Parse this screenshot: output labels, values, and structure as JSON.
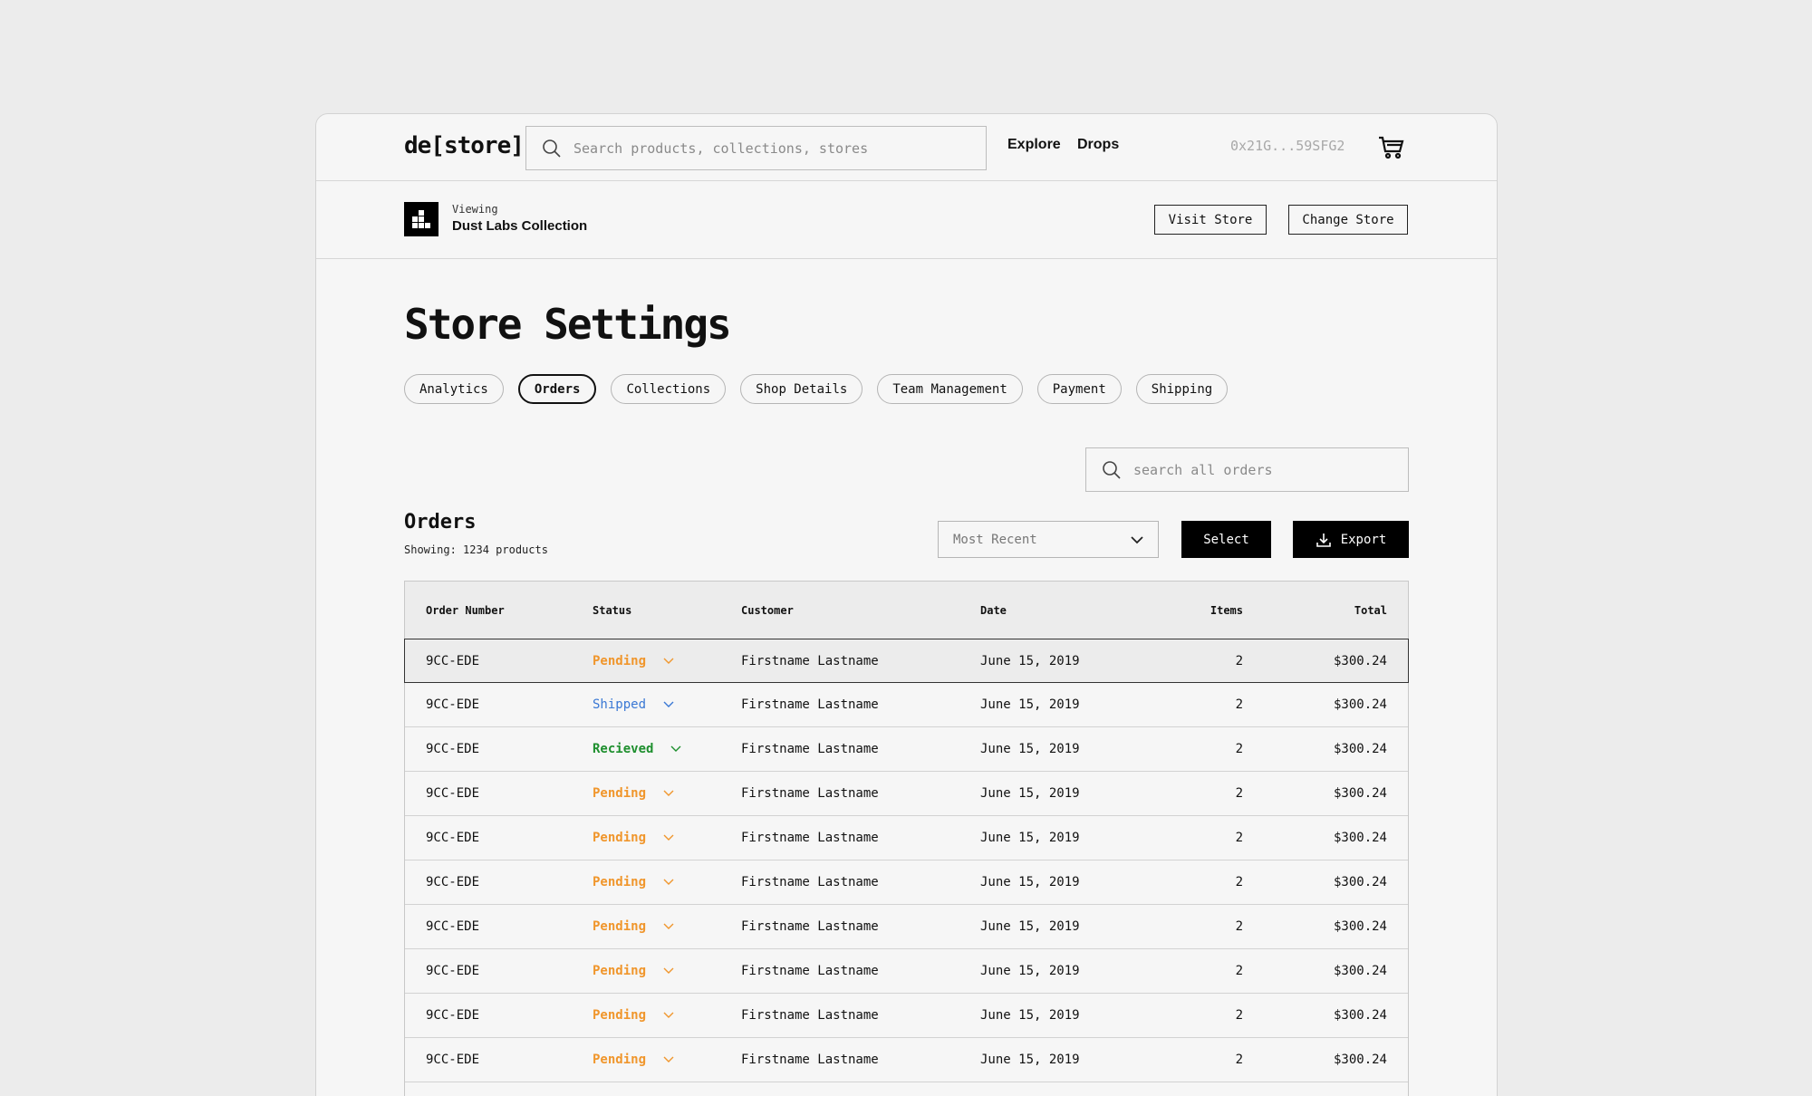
{
  "header": {
    "logo": "de[store]",
    "search_placeholder": "Search products, collections, stores",
    "nav": [
      "Explore",
      "Drops"
    ],
    "wallet": "0x21G...59SFG2"
  },
  "store": {
    "viewing_label": "Viewing",
    "name": "Dust Labs Collection",
    "visit_label": "Visit Store",
    "change_label": "Change Store"
  },
  "page": {
    "title": "Store Settings",
    "tabs": [
      {
        "label": "Analytics",
        "active": false
      },
      {
        "label": "Orders",
        "active": true
      },
      {
        "label": "Collections",
        "active": false
      },
      {
        "label": "Shop Details",
        "active": false
      },
      {
        "label": "Team Management",
        "active": false
      },
      {
        "label": "Payment",
        "active": false
      },
      {
        "label": "Shipping",
        "active": false
      }
    ]
  },
  "orders": {
    "search_placeholder": "search all orders",
    "title": "Orders",
    "count_text": "Showing: 1234 products",
    "sort_value": "Most Recent",
    "select_label": "Select",
    "export_label": "Export",
    "columns": [
      "Order Number",
      "Status",
      "Customer",
      "Date",
      "Items",
      "Total"
    ],
    "rows": [
      {
        "num": "9CC-EDE",
        "status": "Pending",
        "customer": "Firstname Lastname",
        "date": "June 15, 2019",
        "items": "2",
        "total": "$300.24"
      },
      {
        "num": "9CC-EDE",
        "status": "Shipped",
        "customer": "Firstname Lastname",
        "date": "June 15, 2019",
        "items": "2",
        "total": "$300.24"
      },
      {
        "num": "9CC-EDE",
        "status": "Recieved",
        "customer": "Firstname Lastname",
        "date": "June 15, 2019",
        "items": "2",
        "total": "$300.24"
      },
      {
        "num": "9CC-EDE",
        "status": "Pending",
        "customer": "Firstname Lastname",
        "date": "June 15, 2019",
        "items": "2",
        "total": "$300.24"
      },
      {
        "num": "9CC-EDE",
        "status": "Pending",
        "customer": "Firstname Lastname",
        "date": "June 15, 2019",
        "items": "2",
        "total": "$300.24"
      },
      {
        "num": "9CC-EDE",
        "status": "Pending",
        "customer": "Firstname Lastname",
        "date": "June 15, 2019",
        "items": "2",
        "total": "$300.24"
      },
      {
        "num": "9CC-EDE",
        "status": "Pending",
        "customer": "Firstname Lastname",
        "date": "June 15, 2019",
        "items": "2",
        "total": "$300.24"
      },
      {
        "num": "9CC-EDE",
        "status": "Pending",
        "customer": "Firstname Lastname",
        "date": "June 15, 2019",
        "items": "2",
        "total": "$300.24"
      },
      {
        "num": "9CC-EDE",
        "status": "Pending",
        "customer": "Firstname Lastname",
        "date": "June 15, 2019",
        "items": "2",
        "total": "$300.24"
      },
      {
        "num": "9CC-EDE",
        "status": "Pending",
        "customer": "Firstname Lastname",
        "date": "June 15, 2019",
        "items": "2",
        "total": "$300.24"
      }
    ]
  },
  "colors": {
    "pending": "#f0962c",
    "shipped": "#3a78d4",
    "recieved": "#1e8f2e",
    "background": "#ececec",
    "panel": "#f6f6f6"
  },
  "icons": [
    "search-icon",
    "cart-icon",
    "store-logo-icon",
    "chevron-down-icon",
    "download-icon"
  ]
}
